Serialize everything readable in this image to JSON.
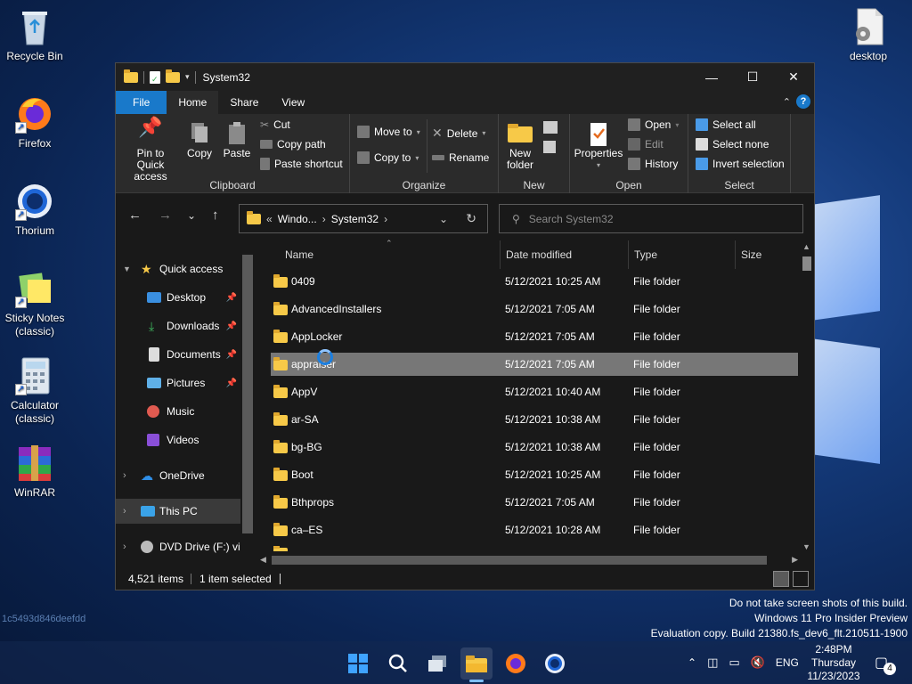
{
  "desktop": {
    "icons": [
      {
        "label": "Recycle Bin"
      },
      {
        "label": "Firefox"
      },
      {
        "label": "Thorium"
      },
      {
        "label": "Sticky Notes (classic)"
      },
      {
        "label": "Calculator (classic)"
      },
      {
        "label": "WinRAR"
      },
      {
        "label": "desktop"
      }
    ],
    "side_id": "1c5493d846deefdd",
    "watermark": [
      "Do not take screen shots of this build.",
      "Windows 11 Pro Insider Preview",
      "Evaluation copy. Build 21380.fs_dev6_flt.210511-1900"
    ]
  },
  "window": {
    "title": "System32",
    "controls": {
      "minimize": "—",
      "maximize": "☐",
      "close": "✕"
    },
    "ribbon_tabs": [
      "File",
      "Home",
      "Share",
      "View"
    ],
    "ribbon": {
      "clipboard": {
        "label": "Clipboard",
        "pin": "Pin to Quick access",
        "copy": "Copy",
        "paste": "Paste",
        "cut": "Cut",
        "copy_path": "Copy path",
        "paste_shortcut": "Paste shortcut"
      },
      "organize": {
        "label": "Organize",
        "move_to": "Move to",
        "copy_to": "Copy to",
        "delete": "Delete",
        "rename": "Rename"
      },
      "new": {
        "label": "New",
        "new_folder": "New folder"
      },
      "open": {
        "label": "Open",
        "properties": "Properties",
        "open": "Open",
        "edit": "Edit",
        "history": "History"
      },
      "select": {
        "label": "Select",
        "select_all": "Select all",
        "select_none": "Select none",
        "invert": "Invert selection"
      }
    },
    "address": {
      "crumbs": [
        "«",
        "Windo...",
        "System32"
      ],
      "search_placeholder": "Search System32"
    },
    "nav": [
      {
        "label": "Quick access"
      },
      {
        "label": "Desktop"
      },
      {
        "label": "Downloads"
      },
      {
        "label": "Documents"
      },
      {
        "label": "Pictures"
      },
      {
        "label": "Music"
      },
      {
        "label": "Videos"
      },
      {
        "label": "OneDrive"
      },
      {
        "label": "This PC"
      },
      {
        "label": "DVD Drive (F:) vir"
      }
    ],
    "columns": {
      "name": "Name",
      "date": "Date modified",
      "type": "Type",
      "size": "Size"
    },
    "files": [
      {
        "name": "0409",
        "date": "5/12/2021 10:25 AM",
        "type": "File folder"
      },
      {
        "name": "AdvancedInstallers",
        "date": "5/12/2021 7:05 AM",
        "type": "File folder"
      },
      {
        "name": "AppLocker",
        "date": "5/12/2021 7:05 AM",
        "type": "File folder"
      },
      {
        "name": "appraiser",
        "date": "5/12/2021 7:05 AM",
        "type": "File folder"
      },
      {
        "name": "AppV",
        "date": "5/12/2021 10:40 AM",
        "type": "File folder"
      },
      {
        "name": "ar-SA",
        "date": "5/12/2021 10:38 AM",
        "type": "File folder"
      },
      {
        "name": "bg-BG",
        "date": "5/12/2021 10:38 AM",
        "type": "File folder"
      },
      {
        "name": "Boot",
        "date": "5/12/2021 10:25 AM",
        "type": "File folder"
      },
      {
        "name": "Bthprops",
        "date": "5/12/2021 7:05 AM",
        "type": "File folder"
      },
      {
        "name": "ca–ES",
        "date": "5/12/2021 10:28 AM",
        "type": "File folder"
      }
    ],
    "status": {
      "items": "4,521 items",
      "selected": "1 item selected"
    }
  },
  "taskbar": {
    "tray": {
      "lang": "ENG",
      "time": "2:48PM",
      "day": "Thursday",
      "date": "11/23/2023",
      "notif": "4"
    }
  }
}
